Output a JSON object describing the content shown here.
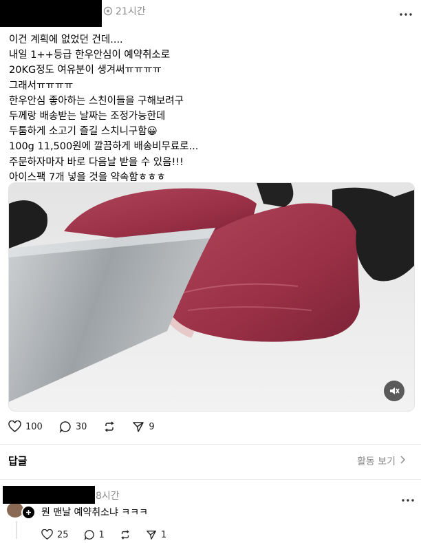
{
  "post": {
    "timestamp": "21시간",
    "lines": [
      "이건 계획에 없었던 건데....",
      "내일 1++등급 한우안심이 예약취소로",
      "20KG정도 여유분이 생겨써ㅠㅠㅠㅠ",
      "그래서ㅠㅠㅠㅠ",
      "한우안심 좋아하는 스친이들을 구해보려구",
      "두께랑 배송받는 날짜는 조정가능한데",
      "두툼하게 소고기 즐길 스치니구함😀",
      "100g 11,500원에 깔끔하게 배송비무료로...",
      "주문하자마자 바로 다음날 받을 수 있음!!!",
      "아이스팩 7개 넣을 것을 약속함ㅎㅎㅎ"
    ],
    "likes": "100",
    "comments": "30",
    "shares": "9"
  },
  "replies_header": {
    "title": "답글",
    "activity_link": "활동 보기"
  },
  "reply": {
    "timestamp": "8시간",
    "text": "뭔 맨날 예약취소냐 ㅋㅋㅋ",
    "likes": "25",
    "comments": "1",
    "shares": "1"
  },
  "icons": [
    "eye-icon",
    "more-icon",
    "heart-icon",
    "comment-icon",
    "repost-icon",
    "share-icon",
    "chevron-right-icon",
    "mute-icon",
    "follow-plus-icon"
  ]
}
